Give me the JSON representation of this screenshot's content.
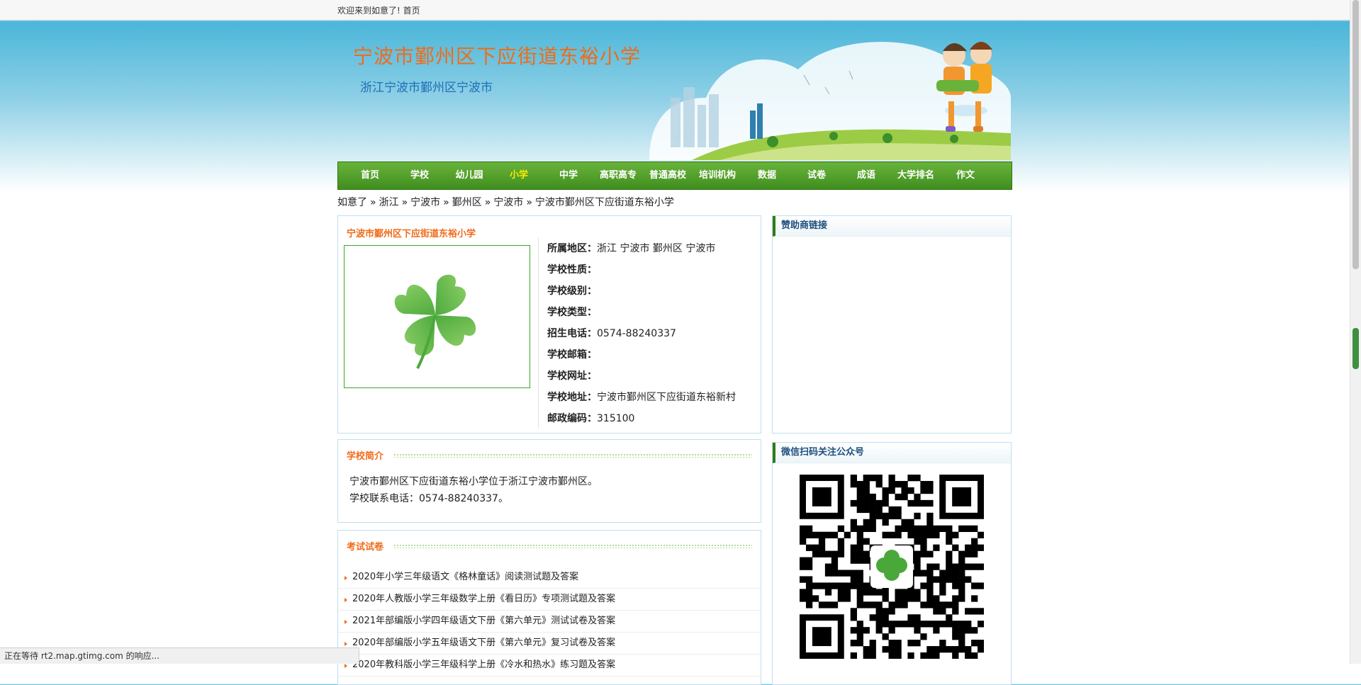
{
  "topbar": {
    "welcome": "欢迎来到如意了!",
    "home_link": "首页"
  },
  "site": {
    "title": "宁波市鄞州区下应街道东裕小学",
    "subtitle": "浙江宁波市鄞州区宁波市"
  },
  "nav": {
    "items": [
      "首页",
      "学校",
      "幼儿园",
      "小学",
      "中学",
      "高职高专",
      "普通高校",
      "培训机构",
      "数据",
      "试卷",
      "成语",
      "大学排名",
      "作文"
    ],
    "active_index": 3
  },
  "breadcrumb": [
    "如意了",
    "浙江",
    "宁波市",
    "鄞州区",
    "宁波市",
    "宁波市鄞州区下应街道东裕小学"
  ],
  "breadcrumb_sep": "»",
  "school": {
    "name": "宁波市鄞州区下应街道东裕小学",
    "fields": [
      {
        "label": "所属地区：",
        "value": "浙江 宁波市 鄞州区 宁波市"
      },
      {
        "label": "学校性质：",
        "value": ""
      },
      {
        "label": "学校级别：",
        "value": ""
      },
      {
        "label": "学校类型：",
        "value": ""
      },
      {
        "label": "招生电话：",
        "value": "0574-88240337"
      },
      {
        "label": "学校邮箱：",
        "value": ""
      },
      {
        "label": "学校网址：",
        "value": ""
      },
      {
        "label": "学校地址：",
        "value": "宁波市鄞州区下应街道东裕新村"
      },
      {
        "label": "邮政编码：",
        "value": "315100"
      }
    ]
  },
  "sponsor": {
    "title": "赞助商链接"
  },
  "intro": {
    "title": "学校简介",
    "line1": "宁波市鄞州区下应街道东裕小学位于浙江宁波市鄞州区。",
    "line2": "学校联系电话：0574-88240337。"
  },
  "wechat": {
    "title": "微信扫码关注公众号"
  },
  "exams": {
    "title": "考试试卷",
    "items": [
      "2020年小学三年级语文《格林童话》阅读测试题及答案",
      "2020年人教版小学三年级数学上册《看日历》专项测试题及答案",
      "2021年部编版小学四年级语文下册《第六单元》测试试卷及答案",
      "2020年部编版小学五年级语文下册《第六单元》复习试卷及答案",
      "2020年教科版小学三年级科学上册《冷水和热水》练习题及答案"
    ]
  },
  "status": {
    "text": "正在等待 rt2.map.gtimg.com 的响应..."
  },
  "colors": {
    "nav_green": "#4a9a27",
    "title_orange": "#f06b1a",
    "sub_blue": "#1e6fb8",
    "active_yellow": "#ffea00"
  }
}
